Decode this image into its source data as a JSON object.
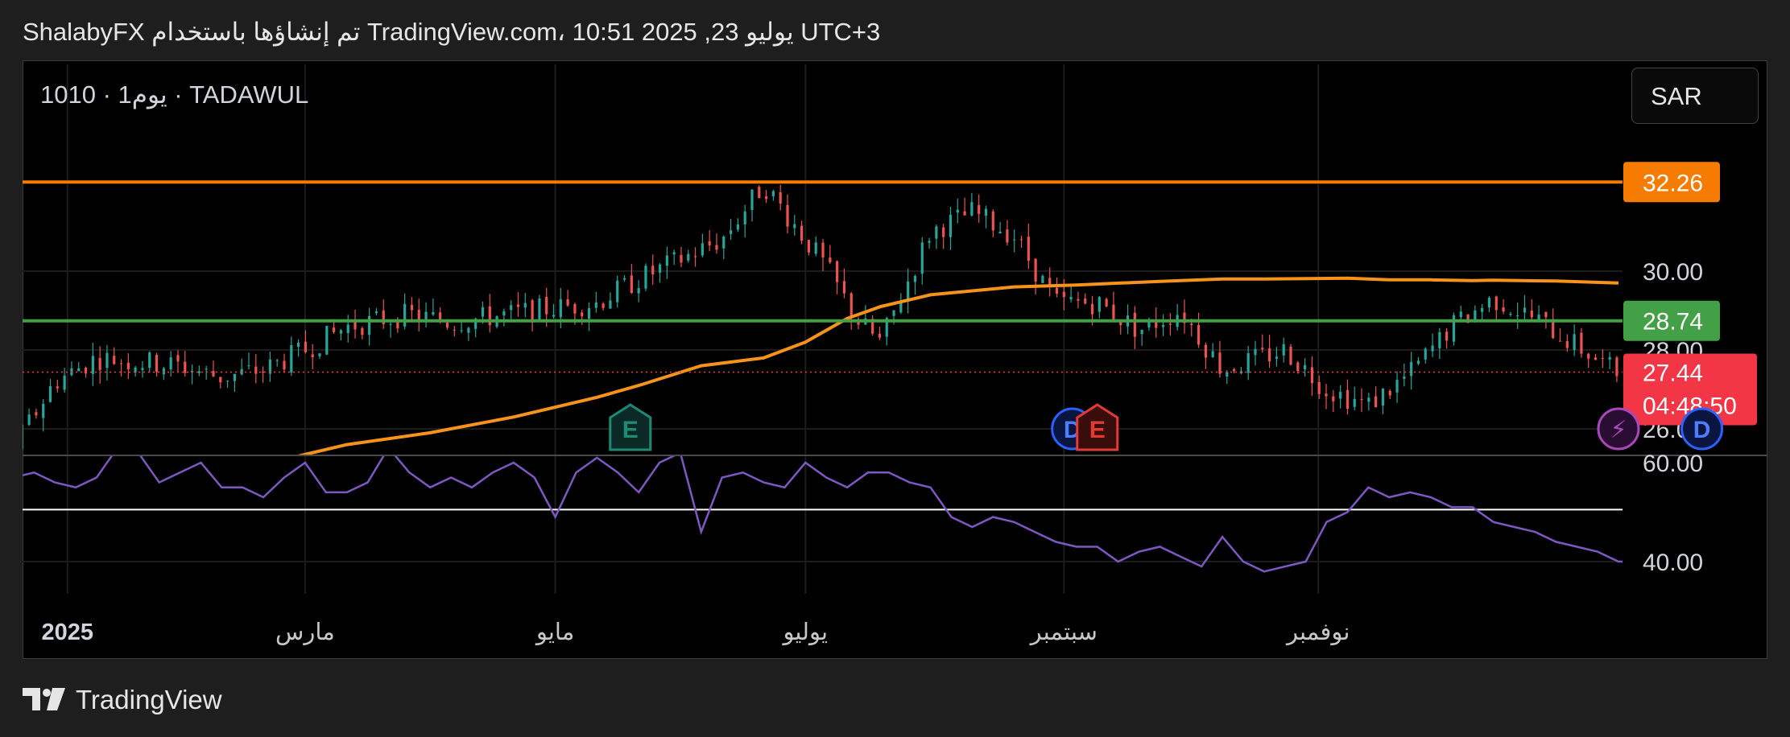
{
  "header": {
    "attribution": "ShalabyFX تم إنشاؤها باستخدام TradingView.com، 10:51 2025 ,23 يوليو UTC+3"
  },
  "symbol": {
    "label": "1010 · 1يوم · TADAWUL"
  },
  "currency": {
    "label": "SAR"
  },
  "footer": {
    "brand": "TradingView"
  },
  "colors": {
    "up": "#26a69a",
    "down": "#ef5350",
    "ma": "#f7931a",
    "rsi": "#7e57c2",
    "resistance": "#f57c00",
    "support": "#43a047",
    "price": "#f23645"
  },
  "chart_data": {
    "type": "candlestick",
    "title": "",
    "timeframe": "1يوم",
    "exchange": "TADAWUL",
    "ticker": "1010",
    "currency": "SAR",
    "price_axis": {
      "ticks": [
        "30.00",
        "28.00",
        "26.00"
      ],
      "range": [
        24.6,
        33.5
      ]
    },
    "time_axis": {
      "ticks": [
        "سبتمبر",
        "نوفمبر",
        "2025",
        "مارس",
        "مايو",
        "يوليو",
        "سبتمبر",
        "نوفمبر"
      ],
      "range_days": [
        -11,
        520
      ]
    },
    "horizontal_lines": [
      {
        "name": "resistance",
        "value": 32.26,
        "label": "32.26"
      },
      {
        "name": "support",
        "value": 28.74,
        "label": "28.74"
      }
    ],
    "last_price": {
      "value": 27.44,
      "label": "27.44",
      "countdown": "04:48:50"
    },
    "moving_average": {
      "x_days": [
        120,
        150,
        170,
        190,
        210,
        230,
        250,
        260,
        275,
        290,
        300,
        310,
        318,
        330,
        350,
        365,
        385,
        400,
        410,
        430,
        440,
        450,
        460,
        465,
        480,
        495
      ],
      "values": [
        24.0,
        24.7,
        25.1,
        25.6,
        25.9,
        26.3,
        26.8,
        27.1,
        27.6,
        27.8,
        28.2,
        28.8,
        29.1,
        29.4,
        29.6,
        29.65,
        29.74,
        29.8,
        29.8,
        29.82,
        29.78,
        29.78,
        29.76,
        29.77,
        29.75,
        29.7
      ]
    },
    "events": [
      {
        "type": "E",
        "day": 95,
        "style": "earnings-past"
      },
      {
        "type": "E",
        "day": 258,
        "style": "earnings-past"
      },
      {
        "type": "D",
        "day": 364,
        "style": "dividend-past"
      },
      {
        "type": "E",
        "day": 370,
        "style": "earnings-past-red"
      },
      {
        "type": "⚡",
        "day": 495,
        "style": "split"
      },
      {
        "type": "D",
        "day": 515,
        "style": "dividend-future"
      },
      {
        "type": "E",
        "day": 640,
        "style": "earnings-future"
      }
    ],
    "rsi": {
      "ticks": [
        "60.00",
        "40.00"
      ],
      "range": [
        35,
        62
      ],
      "reference_level": 50.5,
      "x_days": [
        -12,
        -6,
        0,
        5,
        10,
        15,
        20,
        25,
        30,
        35,
        40,
        45,
        50,
        55,
        60,
        65,
        70,
        75,
        80,
        85,
        90,
        95,
        100,
        105,
        110,
        115,
        120,
        125,
        130,
        135,
        140,
        145,
        150,
        155,
        160,
        165,
        170,
        175,
        180,
        185,
        190,
        195,
        200,
        205,
        210,
        215,
        220,
        225,
        230,
        235,
        240,
        245,
        250,
        255,
        260,
        265,
        270,
        275,
        280,
        285,
        290,
        295,
        300,
        305,
        310,
        315,
        320,
        325,
        330,
        335,
        340,
        345,
        350,
        355,
        360,
        365,
        370,
        375,
        380,
        385,
        390,
        395,
        400,
        405,
        410,
        415,
        420,
        425,
        430,
        435,
        440,
        445,
        450,
        455,
        460,
        465,
        470,
        475,
        480,
        485,
        490,
        495,
        500
      ],
      "values": [
        45,
        47,
        56,
        60,
        54,
        51,
        53,
        48,
        44,
        43,
        48,
        51,
        50,
        44,
        45,
        45,
        46,
        44,
        49,
        54,
        58,
        57,
        56,
        58,
        57,
        58,
        56,
        55,
        57,
        63,
        62,
        56,
        58,
        60,
        55,
        55,
        53,
        57,
        60,
        54,
        54,
        56,
        63,
        58,
        55,
        57,
        55,
        58,
        60,
        57,
        49,
        58,
        61,
        58,
        54,
        60,
        62,
        46,
        57,
        58,
        56,
        55,
        60,
        57,
        55,
        58,
        58,
        56,
        55,
        49,
        47,
        49,
        48,
        46,
        44,
        43,
        43,
        40,
        42,
        43,
        41,
        39,
        45,
        40,
        38,
        39,
        40,
        48,
        50,
        55,
        53,
        54,
        53,
        51,
        51,
        48,
        47,
        46,
        44,
        43,
        42,
        40,
        40
      ]
    }
  }
}
